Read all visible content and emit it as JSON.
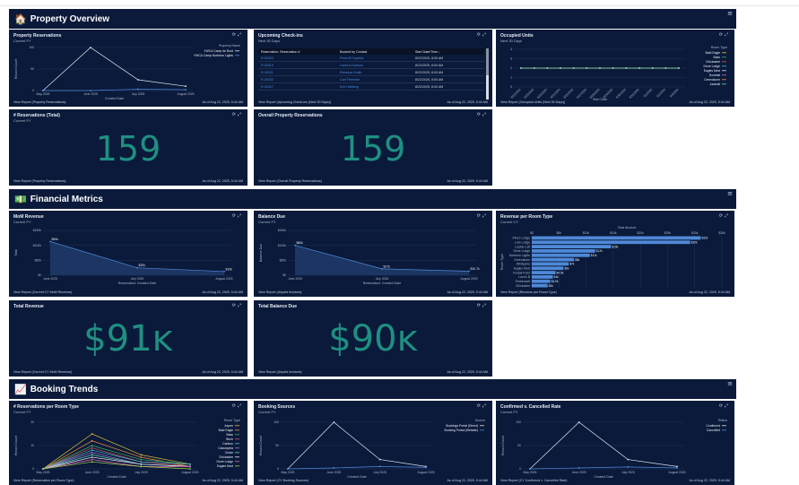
{
  "sections": {
    "property": {
      "emoji": "🏠",
      "title": "Property Overview"
    },
    "financial": {
      "emoji": "💵",
      "title": "Financial Metrics"
    },
    "booking": {
      "emoji": "📈",
      "title": "Booking Trends"
    }
  },
  "icons": {
    "menu": "≡",
    "refresh": "⟳",
    "expand": "⤢"
  },
  "cards": {
    "property_reservations": {
      "title": "Property Reservations",
      "subtitle": "Current FY",
      "view_report": "View Report (Property Reservations)",
      "as_of": "As of Aug 22, 2025, 5:44 AM",
      "chart_data": {
        "type": "line",
        "x": [
          "May 2025",
          "June 2025",
          "July 2025",
          "August 2025"
        ],
        "series": [
          {
            "name": "YWCA Camp de Bord",
            "values": [
              0,
              100,
              25,
              10
            ],
            "color": "#dfe6f2"
          },
          {
            "name": "YWCA Camp Northern Lights",
            "values": [
              0,
              0,
              3,
              2
            ],
            "color": "#4f89d8"
          }
        ],
        "ylim": [
          0,
          100
        ],
        "yticks": [
          0,
          50,
          100
        ],
        "xlabel": "Created Date",
        "ylabel": "Record Count",
        "legend_title": "Property Name",
        "legend_position": "right"
      }
    },
    "upcoming_checkins": {
      "title": "Upcoming Check-ins",
      "subtitle": "Next 30 Days",
      "view_report": "View Report (Upcoming Check-ins (Next 30 Days))",
      "as_of": "As of Aug 22, 2025, 5:44 AM",
      "columns": [
        "Reservation: Reservation #",
        "Booked by Contact",
        "Start Date/Time ↓"
      ],
      "rows": [
        {
          "res": "R-00323",
          "contact": "Prina M Hopkins",
          "date": "8/22/2025, 8:00 AM"
        },
        {
          "res": "R-00319",
          "contact": "Laura A Dobson",
          "date": "8/22/2025, 8:00 AM"
        },
        {
          "res": "R-00321",
          "contact": "Rebecca Smith",
          "date": "8/22/2025, 8:00 AM"
        },
        {
          "res": "R-00330",
          "contact": "Carl Freeman",
          "date": "8/22/2025, 8:00 AM"
        },
        {
          "res": "R-00327",
          "contact": "Erin Hallberg",
          "date": "8/22/2025, 8:00 AM"
        }
      ]
    },
    "occupied_units": {
      "title": "Occupied Units",
      "subtitle": "Next 30 Days",
      "view_report": "View Report (Occupied Units (Next 30 Days))",
      "as_of": "As of Aug 22, 2025, 5:44 AM",
      "chart_data": {
        "type": "line",
        "x": [
          "8/22/2025",
          "8/23/2025",
          "8/24/2025",
          "8/25/2025",
          "8/26/2025",
          "8/27/2025",
          "8/28/2025",
          "8/29/2025",
          "8/30/2025",
          "8/31/2025",
          "9/1/2025",
          "9/2/2025",
          "9/3/2025"
        ],
        "series": [
          {
            "name": "Bald Eagle",
            "values": [
              2,
              2,
              2,
              2,
              2,
              2,
              2,
              2,
              2,
              2,
              2,
              2,
              2
            ],
            "color": "#e2c23a"
          },
          {
            "name": "Bass",
            "values": [
              2,
              2,
              2,
              2,
              2,
              2,
              2,
              2,
              2,
              2,
              2,
              2,
              2
            ],
            "color": "#3fae5a"
          },
          {
            "name": "Chickadee",
            "values": [
              2,
              2,
              2,
              2,
              2,
              2,
              2,
              2,
              2,
              2,
              2,
              2,
              2
            ],
            "color": "#d65a5a"
          },
          {
            "name": "Dene Lodge",
            "values": [
              2,
              2,
              2,
              2,
              2,
              2,
              2,
              2,
              2,
              2,
              2,
              2,
              2
            ],
            "color": "#57b7d6"
          },
          {
            "name": "Eagles Nest",
            "values": [
              2,
              2,
              2,
              2,
              2,
              2,
              2,
              2,
              2,
              2,
              2,
              2,
              2
            ],
            "color": "#dfe6f2"
          },
          {
            "name": "Dovetail",
            "values": [
              2,
              2,
              2,
              2,
              2,
              2,
              2,
              2,
              2,
              2,
              2,
              2,
              2
            ],
            "color": "#a37ad8"
          },
          {
            "name": "Greenstone",
            "values": [
              2,
              2,
              2,
              2,
              2,
              2,
              2,
              2,
              2,
              2,
              2,
              2,
              2
            ],
            "color": "#f08d3c"
          },
          {
            "name": "Jackrail",
            "values": [
              2,
              2,
              2,
              2,
              2,
              2,
              2,
              2,
              2,
              2,
              2,
              2,
              2
            ],
            "color": "#6fd6b4"
          }
        ],
        "ylim": [
          0,
          4
        ],
        "yticks": [
          0,
          1,
          2,
          3,
          4
        ],
        "xlabel": "Start Date",
        "ylabel": "",
        "legend_title": "Room Type",
        "legend_position": "right"
      }
    },
    "reservations_total": {
      "title": "# Reservations (Total)",
      "subtitle": "Current FY",
      "value": "159",
      "view_report": "View Report (Property Reservations)",
      "as_of": "As of Aug 22, 2025, 5:44 AM"
    },
    "overall_reservations": {
      "title": "Overall Property Reservations",
      "subtitle": "",
      "value": "159",
      "view_report": "View Report (Overall Property Reservations)",
      "as_of": "As of Aug 22, 2025, 5:44 AM"
    },
    "mom_revenue": {
      "title": "MoM Revenue",
      "subtitle": "Current FY",
      "view_report": "View Report (Current CY MoM Revenue)",
      "as_of": "As of Aug 22, 2025, 5:44 AM",
      "chart_data": {
        "type": "area",
        "x": [
          "June 2025",
          "July 2025",
          "August 2025"
        ],
        "series": [
          {
            "name": "Total",
            "values": [
              90000,
              20000,
              10000
            ],
            "labels": [
              "$90k",
              "$20k",
              "$10k"
            ],
            "color": "#4f89d8"
          }
        ],
        "ylim": [
          0,
          120000
        ],
        "yticks": [
          "$0",
          "$50k",
          "$100k",
          "$150k"
        ],
        "xlabel": "Reservation: Created Date",
        "ylabel": "Total"
      }
    },
    "balance_due": {
      "title": "Balance Due",
      "subtitle": "Current FY",
      "view_report": "View Report (Unpaid Invoices)",
      "as_of": "As of Aug 22, 2025, 5:44 AM",
      "chart_data": {
        "type": "area",
        "x": [
          "June 2025",
          "July 2025",
          "August 2025"
        ],
        "series": [
          {
            "name": "Balance Due",
            "values": [
              80000,
              17000,
              10700
            ],
            "labels": [
              "$80k",
              "$17k",
              "$10.7k"
            ],
            "color": "#4f89d8"
          }
        ],
        "ylim": [
          0,
          120000
        ],
        "yticks": [
          "$0",
          "$50k",
          "$100k",
          "$150k"
        ],
        "xlabel": "Reservation: Created Date",
        "ylabel": "Balance Due"
      }
    },
    "revenue_room_type": {
      "title": "Revenue per Room Type",
      "subtitle": "Current CY",
      "view_report": "View Report (Revenue per Room Type)",
      "as_of": "As of Aug 22, 2025, 5:44 AM",
      "chart_data": {
        "type": "bar",
        "orientation": "horizontal",
        "categories": [
          "Pine's Lodge",
          "Lure Lodge",
          "Lupine Loft",
          "Dene Lodge",
          "Northern Lights",
          "Greenstone",
          "Whitepine",
          "Eagles Nest",
          "Foxtail Point",
          "Loon's B",
          "Timberwolf",
          "Chickadee"
        ],
        "values": [
          32000,
          30000,
          15000,
          12000,
          11000,
          8000,
          7000,
          6000,
          4500,
          4000,
          3500,
          3000
        ],
        "labels": [
          "$32k",
          "$30k",
          "$15k",
          "$12k",
          "$11k",
          "$8k",
          "$7k",
          "$6k",
          "$4.5k",
          "$4k",
          "$3.5k",
          "$3k"
        ],
        "color": "#4f89d8",
        "xlim": [
          0,
          36000
        ],
        "xticks": [
          "$0",
          "$5k",
          "$10k",
          "$15k",
          "$20k",
          "$25k",
          "$30k",
          "$35k"
        ],
        "xlabel": "Total Amount",
        "ylabel": "Room Type"
      }
    },
    "total_revenue": {
      "title": "Total Revenue",
      "subtitle": "",
      "value": "$91ĸ",
      "view_report": "View Report (Current CY MoM Revenue)",
      "as_of": "As of Aug 22, 2025, 5:44 AM"
    },
    "total_balance_due": {
      "title": "Total Balance Due",
      "subtitle": "",
      "value": "$90ĸ",
      "view_report": "View Report (Unpaid Invoices)",
      "as_of": "As of Aug 22, 2025, 5:44 AM"
    },
    "res_per_room": {
      "title": "# Reservations per Room Type",
      "subtitle": "Current FY",
      "view_report": "View Report (Reservation per Room Type)",
      "as_of": "As of Aug 22, 2025, 5:44 AM",
      "chart_data": {
        "type": "line",
        "x": [
          "May 2025",
          "June 2025",
          "July 2025",
          "August 2025"
        ],
        "series": [
          {
            "name": "Aspen",
            "values": [
              0,
              15,
              6,
              2
            ],
            "color": "#e2c23a"
          },
          {
            "name": "Bald Eagle",
            "values": [
              0,
              12,
              5,
              1
            ],
            "color": "#f08d3c"
          },
          {
            "name": "Bass",
            "values": [
              0,
              10,
              4,
              2
            ],
            "color": "#3fae5a"
          },
          {
            "name": "Birch",
            "values": [
              0,
              9,
              3,
              1
            ],
            "color": "#d65a5a"
          },
          {
            "name": "Caribou",
            "values": [
              0,
              8,
              3,
              2
            ],
            "color": "#57b7d6"
          },
          {
            "name": "Cassiopeia",
            "values": [
              0,
              7,
              2,
              1
            ],
            "color": "#a37ad8"
          },
          {
            "name": "Cedar",
            "values": [
              0,
              6,
              2,
              1
            ],
            "color": "#6fd6b4"
          },
          {
            "name": "Chickadee",
            "values": [
              0,
              5,
              2,
              1
            ],
            "color": "#dfe6f2"
          },
          {
            "name": "Dene Lodge",
            "values": [
              0,
              4,
              1,
              1
            ],
            "color": "#e26bb0"
          },
          {
            "name": "Eagles Nest",
            "values": [
              0,
              3,
              1,
              0
            ],
            "color": "#9fd64a"
          }
        ],
        "ylim": [
          0,
          20
        ],
        "yticks": [
          0,
          10,
          20
        ],
        "xlabel": "Created Date",
        "ylabel": "Record Count",
        "legend_title": "Room Type",
        "legend_position": "right"
      }
    },
    "booking_sources": {
      "title": "Booking Sources",
      "subtitle": "Current FY",
      "view_report": "View Report (CY Booking Sources)",
      "as_of": "As of Aug 22, 2025, 5:44 AM",
      "chart_data": {
        "type": "line",
        "x": [
          "May 2025",
          "June 2025",
          "July 2025",
          "August 2025"
        ],
        "series": [
          {
            "name": "Bookings Portal (Direct)",
            "values": [
              0,
              100,
              20,
              5
            ],
            "color": "#dfe6f2"
          },
          {
            "name": "Booking Portal (Website)",
            "values": [
              0,
              2,
              5,
              3
            ],
            "color": "#4f89d8"
          }
        ],
        "ylim": [
          0,
          100
        ],
        "yticks": [
          0,
          50,
          100
        ],
        "xlabel": "Created Date",
        "ylabel": "Record Count",
        "legend_title": "Source",
        "legend_position": "right"
      }
    },
    "confirmed_cancelled": {
      "title": "Confirmed v. Cancelled Rate",
      "subtitle": "Current FY",
      "view_report": "View Report (CY Confirmed v. Cancelled Rate)",
      "as_of": "As of Aug 22, 2025, 5:44 AM",
      "chart_data": {
        "type": "line",
        "x": [
          "May 2025",
          "June 2025",
          "July 2025",
          "August 2025"
        ],
        "series": [
          {
            "name": "Confirmed",
            "values": [
              0,
              100,
              20,
              5
            ],
            "color": "#dfe6f2"
          },
          {
            "name": "Cancelled",
            "values": [
              0,
              2,
              4,
              2
            ],
            "color": "#4f89d8"
          }
        ],
        "ylim": [
          0,
          100
        ],
        "yticks": [
          0,
          50,
          100
        ],
        "xlabel": "Created Date",
        "ylabel": "Record Count",
        "legend_title": "Status",
        "legend_position": "right"
      }
    }
  }
}
